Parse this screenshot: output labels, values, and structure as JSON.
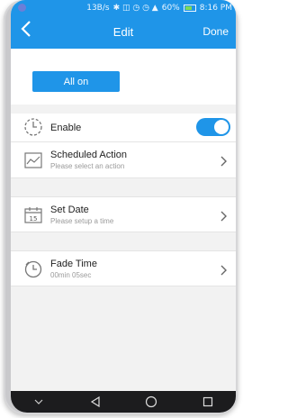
{
  "status": {
    "speed": "13B/s",
    "battery": "60%",
    "time": "8:16 PM"
  },
  "header": {
    "title": "Edit",
    "done_label": "Done"
  },
  "actions": {
    "all_on_label": "All on"
  },
  "enable": {
    "label": "Enable",
    "on": true
  },
  "scheduled_action": {
    "title": "Scheduled Action",
    "subtitle": "Please select an action"
  },
  "set_date": {
    "title": "Set Date",
    "subtitle": "Please setup a time",
    "calendar_number": "15"
  },
  "fade_time": {
    "title": "Fade Time",
    "value": "00min  05sec"
  },
  "colors": {
    "accent": "#1f95e8"
  }
}
